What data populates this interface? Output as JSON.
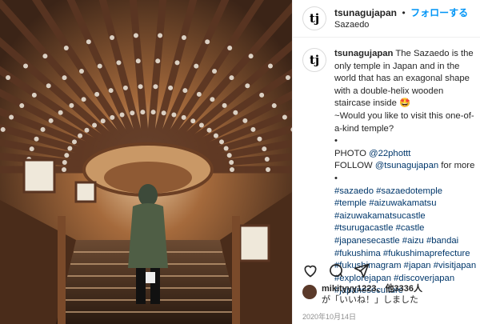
{
  "account": {
    "username": "tsunagujapan",
    "location": "Sazaedo",
    "follow_label": "フォローする",
    "avatar_text": "tj"
  },
  "caption": {
    "username": "tsunagujapan",
    "line1": "The Sazaedo is the only temple in Japan and in the world that has an exagonal shape with a double-helix wooden staircase inside",
    "emoji": "🤩",
    "line2": "~Would you like to visit this one-of-a-kind temple?",
    "bullet": "•",
    "photo_label": "PHOTO ",
    "photo_handle": "@22phottt",
    "follow_label": "FOLLOW ",
    "follow_handle": "@tsunagujapan",
    "follow_tail": " for more",
    "hashtags": [
      "#sazaedo",
      "#sazaedotemple",
      "#temple",
      "#aizuwakamatsu",
      "#aizuwakamatsucastle",
      "#tsurugacastle",
      "#castle",
      "#japanesecastle",
      "#aizu",
      "#bandai",
      "#fukushima",
      "#fukushimaprefecture",
      "#fukushimagram",
      "#japan",
      "#visitjapan",
      "#explorejapan",
      "#discoverjapan",
      "#japaneseculture"
    ]
  },
  "likes": {
    "name": "mikityyy1223",
    "text": "、他3336人",
    "line2": "が「いいね！」しました"
  },
  "date": "2020年10月14日",
  "colors": {
    "link": "#00376b",
    "follow": "#0095f6"
  }
}
